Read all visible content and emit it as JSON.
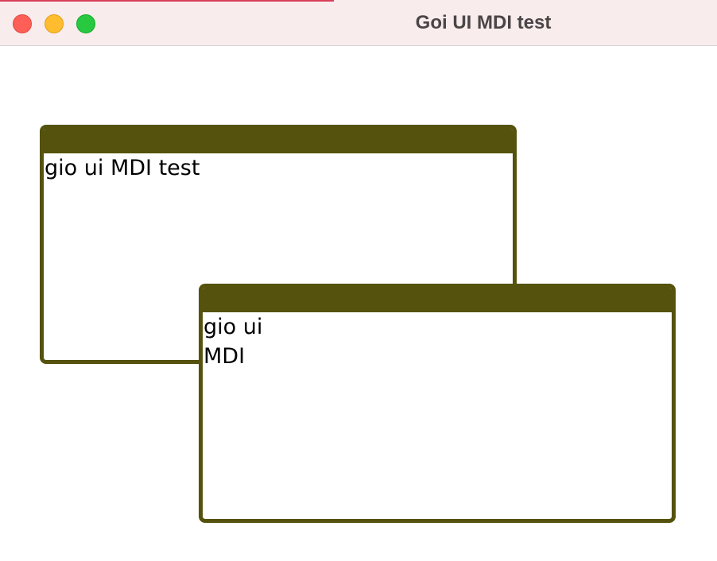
{
  "window": {
    "title": "Goi UI MDI test",
    "controls": {
      "close": "close-icon",
      "minimize": "minimize-icon",
      "zoom": "zoom-icon"
    }
  },
  "mdi_windows": [
    {
      "body_text": "gio ui MDI test"
    },
    {
      "body_text": "gio ui\nMDI"
    }
  ],
  "colors": {
    "mdi_frame": "#54520c",
    "titlebar_bg": "#f8eced",
    "close": "#fe5f57",
    "minimize": "#febc2e",
    "zoom": "#28c840"
  }
}
